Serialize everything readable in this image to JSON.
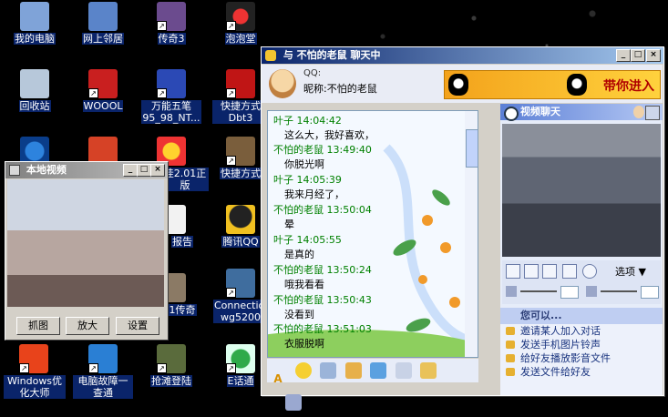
{
  "desktop": {
    "icons": [
      {
        "label": "我的电脑",
        "icon": "my-computer-icon"
      },
      {
        "label": "网上邻居",
        "icon": "network-icon"
      },
      {
        "label": "传奇3",
        "icon": "game-icon"
      },
      {
        "label": "泡泡堂",
        "icon": "game-icon"
      },
      {
        "label": "回收站",
        "icon": "recycle-bin-icon"
      },
      {
        "label": "WOOOL",
        "icon": "game-icon"
      },
      {
        "label": "万能五笔95_98_NT...",
        "icon": "ime-icon"
      },
      {
        "label": "快捷方式Dbt3",
        "icon": "shortcut-icon"
      },
      {
        "label": "快捷方式",
        "icon": "shortcut-icon"
      },
      {
        "label": "挂2.01正版",
        "icon": "app-icon"
      },
      {
        "label": "报告",
        "icon": "document-icon"
      },
      {
        "label": "腾讯QQ",
        "icon": "qq-icon"
      },
      {
        "label": "1传奇",
        "icon": "game-icon"
      },
      {
        "label": "Connection wg5200",
        "icon": "network-icon"
      },
      {
        "label": "Windows优化大师",
        "icon": "app-icon"
      },
      {
        "label": "电脑故障一查通",
        "icon": "app-icon"
      },
      {
        "label": "抢滩登陆",
        "icon": "game-icon"
      },
      {
        "label": "E话通",
        "icon": "app-icon"
      }
    ]
  },
  "chat_window": {
    "title": "与 不怕的老鼠 聊天中",
    "qq_label": "QQ:",
    "nickname_label": "昵称:",
    "nickname": "不怕的老鼠",
    "ad_text": "带你进入",
    "messages": [
      {
        "sender": "叶子",
        "time": "14:04:42",
        "text": "这么大，我好喜欢，"
      },
      {
        "sender": "不怕的老鼠",
        "time": "13:49:40",
        "text": "你脱光啊"
      },
      {
        "sender": "叶子",
        "time": "14:05:39",
        "text": "我来月经了，"
      },
      {
        "sender": "不怕的老鼠",
        "time": "13:50:04",
        "text": "晕"
      },
      {
        "sender": "叶子",
        "time": "14:05:55",
        "text": "是真的"
      },
      {
        "sender": "不怕的老鼠",
        "time": "13:50:24",
        "text": "哦我看看"
      },
      {
        "sender": "不怕的老鼠",
        "time": "13:50:43",
        "text": "没看到"
      },
      {
        "sender": "不怕的老鼠",
        "time": "13:51:03",
        "text": "衣服脱啊"
      }
    ],
    "video_panel": {
      "title": "视频聊天",
      "options_label": "选项"
    },
    "can_do": {
      "title": "您可以...",
      "items": [
        "邀请某人加入对话",
        "发送手机图片铃声",
        "给好友播放影音文件",
        "发送文件给好友"
      ]
    }
  },
  "local_video_window": {
    "title": "本地视频",
    "buttons": [
      "抓图",
      "放大",
      "设置"
    ]
  }
}
